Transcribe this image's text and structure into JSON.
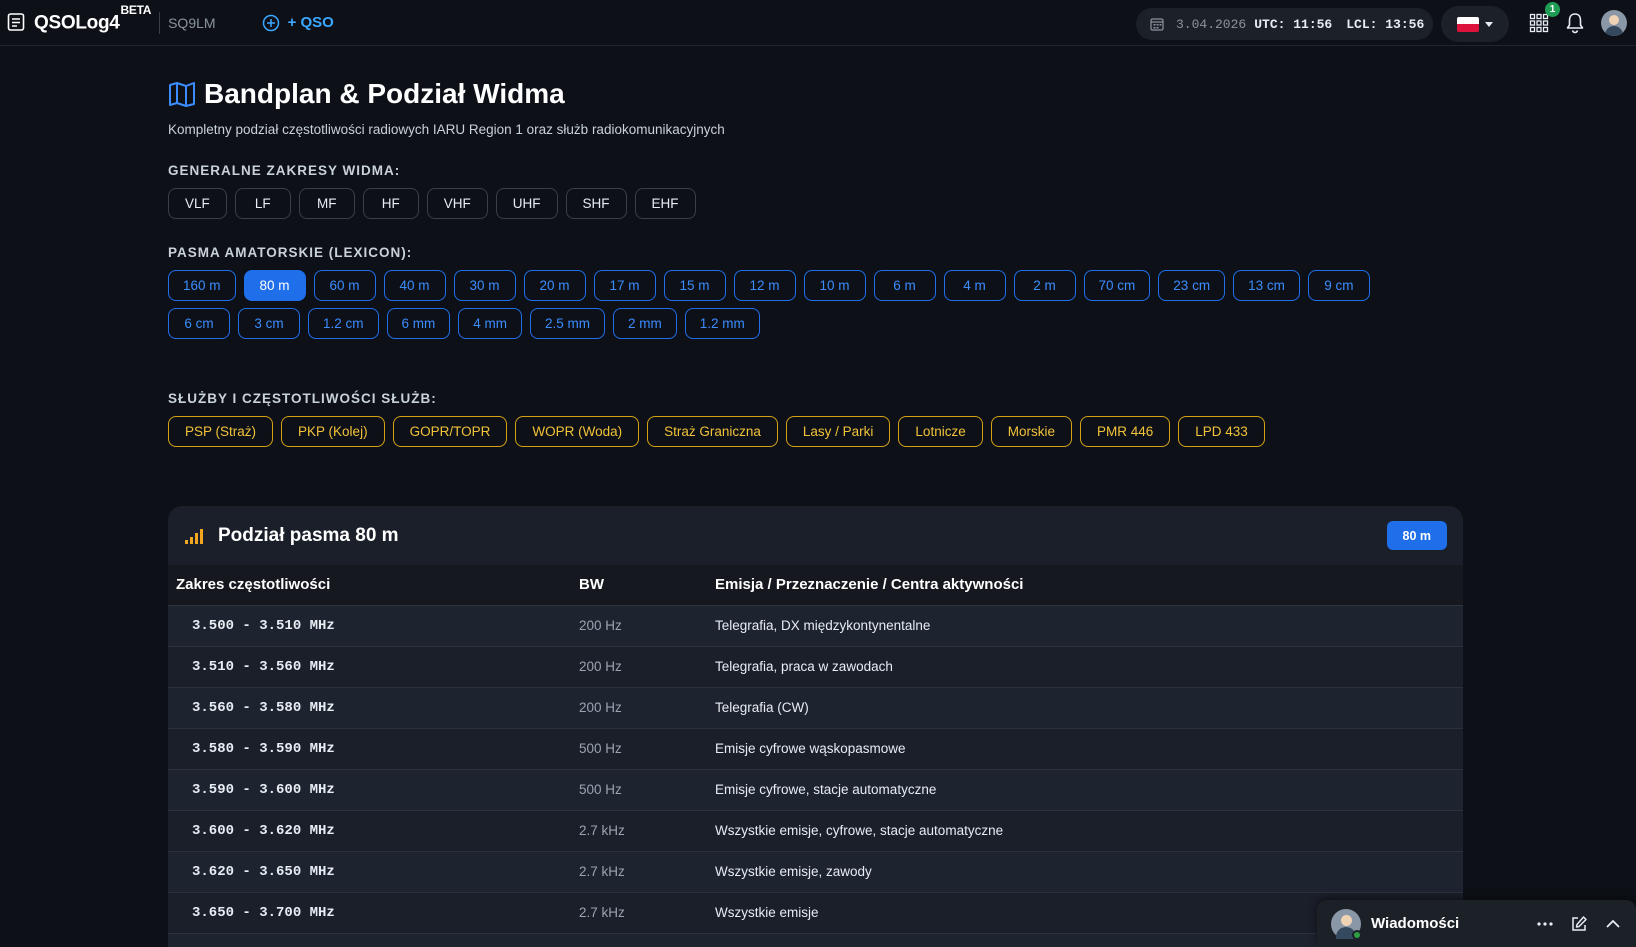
{
  "header": {
    "app_name": "QSOLog4",
    "app_badge": "BETA",
    "callsign": "SQ9LM",
    "add_qso_label": "+ QSO",
    "date": "3.04.2026",
    "utc": "UTC: 11:56",
    "lcl": "LCL: 13:56",
    "language_flag": "pl-flag",
    "apps_badge_count": "1"
  },
  "page": {
    "title": "Bandplan & Podział Widma",
    "subtitle": "Kompletny podział częstotliwości radiowych IARU Region 1 oraz służb radiokomunikacyjnych"
  },
  "spectrum": {
    "label": "GENERALNE ZAKRESY WIDMA:",
    "ranges": [
      "VLF",
      "LF",
      "MF",
      "HF",
      "VHF",
      "UHF",
      "SHF",
      "EHF"
    ]
  },
  "ham_bands": {
    "label": "PASMA AMATORSKIE (LEXICON):",
    "active": "80 m",
    "row1": [
      "160 m",
      "80 m",
      "60 m",
      "40 m",
      "30 m",
      "20 m",
      "17 m",
      "15 m",
      "12 m",
      "10 m",
      "6 m",
      "4 m",
      "2 m",
      "70 cm",
      "23 cm",
      "13 cm",
      "9 cm"
    ],
    "row2": [
      "6 cm",
      "3 cm",
      "1.2 cm",
      "6 mm",
      "4 mm",
      "2.5 mm",
      "2 mm",
      "1.2 mm"
    ]
  },
  "services": {
    "label": "SŁUŻBY I CZĘSTOTLIWOŚCI SŁUŻB:",
    "items": [
      "PSP (Straż)",
      "PKP (Kolej)",
      "GOPR/TOPR",
      "WOPR (Woda)",
      "Straż Graniczna",
      "Lasy / Parki",
      "Lotnicze",
      "Morskie",
      "PMR 446",
      "LPD 433"
    ]
  },
  "band_table": {
    "title": "Podział pasma 80 m",
    "badge": "80 m",
    "columns": [
      "Zakres częstotliwości",
      "BW",
      "Emisja / Przeznaczenie / Centra aktywności"
    ],
    "rows": [
      {
        "range": "3.500 - 3.510 MHz",
        "bw": "200 Hz",
        "emission": "Telegrafia, DX międzykontynentalne"
      },
      {
        "range": "3.510 - 3.560 MHz",
        "bw": "200 Hz",
        "emission": "Telegrafia, praca w zawodach"
      },
      {
        "range": "3.560 - 3.580 MHz",
        "bw": "200 Hz",
        "emission": "Telegrafia (CW)"
      },
      {
        "range": "3.580 - 3.590 MHz",
        "bw": "500 Hz",
        "emission": "Emisje cyfrowe wąskopasmowe"
      },
      {
        "range": "3.590 - 3.600 MHz",
        "bw": "500 Hz",
        "emission": "Emisje cyfrowe, stacje automatyczne"
      },
      {
        "range": "3.600 - 3.620 MHz",
        "bw": "2.7 kHz",
        "emission": "Wszystkie emisje, cyfrowe, stacje automatyczne"
      },
      {
        "range": "3.620 - 3.650 MHz",
        "bw": "2.7 kHz",
        "emission": "Wszystkie emisje, zawody"
      },
      {
        "range": "3.650 - 3.700 MHz",
        "bw": "2.7 kHz",
        "emission": "Wszystkie emisje"
      },
      {
        "range": "",
        "bw": "",
        "emission": ""
      }
    ]
  },
  "messages_dock": {
    "title": "Wiadomości"
  },
  "colors": {
    "background": "#0d1117",
    "accent_blue": "#1f6feb",
    "accent_yellow": "#d4a016",
    "panel": "#1b1f2a"
  }
}
